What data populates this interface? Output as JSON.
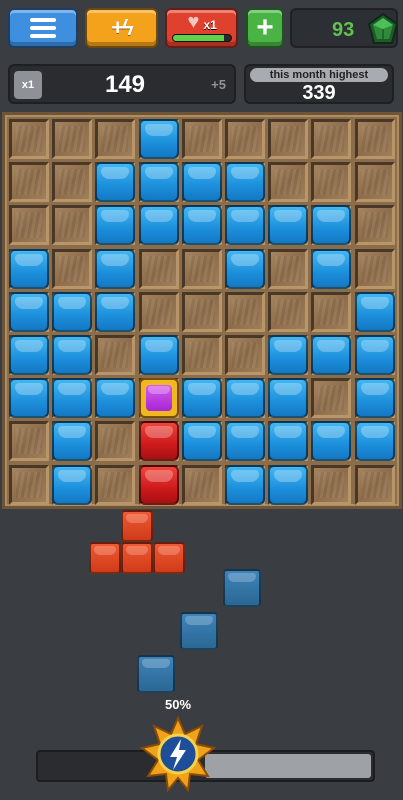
{
  "topbar": {
    "menu": {
      "icon": "menu-icon"
    },
    "boost": {
      "label": "+ϟ",
      "icon": "lightning-icon"
    },
    "life": {
      "multiplier": "x1",
      "icon": "heart-icon",
      "fill_percent": 88
    },
    "add": {
      "label": "+",
      "icon": "plus-icon"
    },
    "gems": {
      "count": "93",
      "icon": "gem-icon"
    }
  },
  "score": {
    "multiplier": "x1",
    "value": "149",
    "delta": "+5",
    "high_label": "this month highest",
    "high_value": "339"
  },
  "board": {
    "rows": 9,
    "cols": 9,
    "grid": [
      ".,.,.,B,.,.,.,.,.",
      ".,.,B,B,B,B,.,.,.",
      ".,.,B,B,B,B,B,B,.",
      "B,.,B,.,.,B,.,B,.",
      "B,B,B,.,.,.,.,.,B",
      "B,B,.,B,.,.,B,B,B",
      "B,B,B,P,B,B,B,.,B",
      ".,B,.,R,B,B,B,B,B",
      ".,B,.,R,.,B,B,.,."
    ],
    "legend": {
      "B": "blue",
      "R": "red",
      "P": "purple-gold",
      ".": "empty"
    }
  },
  "pieces": [
    {
      "name": "orange-t-piece",
      "color": "#e04a25",
      "cells": [
        [
          1,
          0
        ],
        [
          0,
          1
        ],
        [
          1,
          1
        ],
        [
          2,
          1
        ]
      ]
    },
    {
      "name": "steel-diagonal-piece",
      "color": "#3577a8",
      "cells": [
        [
          2,
          0
        ],
        [
          1,
          1
        ],
        [
          0,
          2
        ]
      ]
    }
  ],
  "progress": {
    "percent_label": "50%",
    "percent": 50,
    "badge_icon": "lightning-badge-icon"
  },
  "colors": {
    "blue": "#1f8fdc",
    "red": "#cc1a1c",
    "orange": "#e04a25",
    "steel": "#3577a8",
    "gem_green": "#5fc24d",
    "background": "#3a3d42"
  }
}
